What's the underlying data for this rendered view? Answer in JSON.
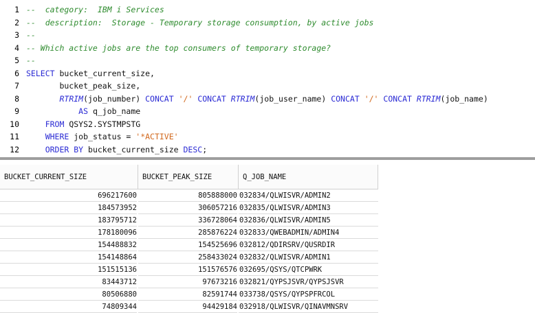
{
  "editor": {
    "lines": [
      {
        "n": "1",
        "parts": [
          {
            "t": "--  category:  IBM i Services",
            "c": "cm"
          }
        ]
      },
      {
        "n": "2",
        "parts": [
          {
            "t": "--  description:  Storage - Temporary storage consumption, by active jobs",
            "c": "cm"
          }
        ]
      },
      {
        "n": "3",
        "parts": [
          {
            "t": "--",
            "c": "cm"
          }
        ]
      },
      {
        "n": "4",
        "parts": [
          {
            "t": "-- Which active jobs are the top consumers of temporary storage?",
            "c": "cm"
          }
        ]
      },
      {
        "n": "5",
        "parts": [
          {
            "t": "--",
            "c": "cm"
          }
        ]
      },
      {
        "n": "6",
        "parts": [
          {
            "t": "SELECT",
            "c": "kw"
          },
          {
            "t": " bucket_current_size,",
            "c": "tx"
          }
        ]
      },
      {
        "n": "7",
        "parts": [
          {
            "t": "       bucket_peak_size,",
            "c": "tx"
          }
        ]
      },
      {
        "n": "8",
        "parts": [
          {
            "t": "       ",
            "c": "tx"
          },
          {
            "t": "RTRIM",
            "c": "fn"
          },
          {
            "t": "(job_number) ",
            "c": "tx"
          },
          {
            "t": "CONCAT",
            "c": "kw"
          },
          {
            "t": " ",
            "c": "tx"
          },
          {
            "t": "'/'",
            "c": "str"
          },
          {
            "t": " ",
            "c": "tx"
          },
          {
            "t": "CONCAT",
            "c": "kw"
          },
          {
            "t": " ",
            "c": "tx"
          },
          {
            "t": "RTRIM",
            "c": "fn"
          },
          {
            "t": "(job_user_name) ",
            "c": "tx"
          },
          {
            "t": "CONCAT",
            "c": "kw"
          },
          {
            "t": " ",
            "c": "tx"
          },
          {
            "t": "'/'",
            "c": "str"
          },
          {
            "t": " ",
            "c": "tx"
          },
          {
            "t": "CONCAT",
            "c": "kw"
          },
          {
            "t": " ",
            "c": "tx"
          },
          {
            "t": "RTRIM",
            "c": "fn"
          },
          {
            "t": "(job_name)",
            "c": "tx"
          }
        ]
      },
      {
        "n": "9",
        "parts": [
          {
            "t": "           ",
            "c": "tx"
          },
          {
            "t": "AS",
            "c": "kw"
          },
          {
            "t": " q_job_name",
            "c": "tx"
          }
        ]
      },
      {
        "n": "10",
        "parts": [
          {
            "t": "    ",
            "c": "tx"
          },
          {
            "t": "FROM",
            "c": "kw"
          },
          {
            "t": " QSYS2.SYSTMPSTG",
            "c": "tx"
          }
        ]
      },
      {
        "n": "11",
        "parts": [
          {
            "t": "    ",
            "c": "tx"
          },
          {
            "t": "WHERE",
            "c": "kw"
          },
          {
            "t": " job_status = ",
            "c": "tx"
          },
          {
            "t": "'*ACTIVE'",
            "c": "str"
          }
        ]
      },
      {
        "n": "12",
        "parts": [
          {
            "t": "    ",
            "c": "tx"
          },
          {
            "t": "ORDER BY",
            "c": "kw"
          },
          {
            "t": " bucket_current_size ",
            "c": "tx"
          },
          {
            "t": "DESC",
            "c": "kw"
          },
          {
            "t": ";",
            "c": "tx"
          }
        ]
      }
    ]
  },
  "results": {
    "columns": [
      "BUCKET_CURRENT_SIZE",
      "BUCKET_PEAK_SIZE",
      "Q_JOB_NAME"
    ],
    "rows": [
      [
        "696217600",
        "805888000",
        "032834/QLWISVR/ADMIN2"
      ],
      [
        "184573952",
        "306057216",
        "032835/QLWISVR/ADMIN3"
      ],
      [
        "183795712",
        "336728064",
        "032836/QLWISVR/ADMIN5"
      ],
      [
        "178180096",
        "285876224",
        "032833/QWEBADMIN/ADMIN4"
      ],
      [
        "154488832",
        "154525696",
        "032812/QDIRSRV/QUSRDIR"
      ],
      [
        "154148864",
        "258433024",
        "032832/QLWISVR/ADMIN1"
      ],
      [
        "151515136",
        "151576576",
        "032695/QSYS/QTCPWRK"
      ],
      [
        "83443712",
        "97673216",
        "032821/QYPSJSVR/QYPSJSVR"
      ],
      [
        "80506880",
        "82591744",
        "033738/QSYS/QYPSPFRCOL"
      ],
      [
        "74809344",
        "94429184",
        "032918/QLWISVR/QINAVMNSRV"
      ]
    ]
  }
}
